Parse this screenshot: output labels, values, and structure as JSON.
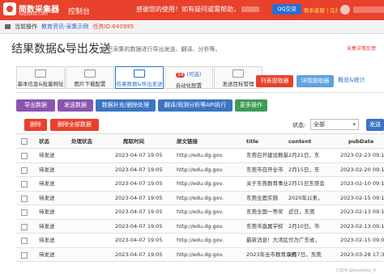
{
  "topbar": {
    "brand": "简数采集器",
    "brand_sub": "keydatas.com",
    "console": "控制台",
    "notice": "感谢您的使用！如有疑问或需帮助，",
    "qq_label": "QQ交谈",
    "contact": "联系客服 | 在线"
  },
  "breadcrumb": {
    "home": "当前操作",
    "section": "教育资讯-采集示例",
    "task": "任务ID:640995"
  },
  "header": {
    "title": "结果数据&导出发送",
    "description": "*对已采集的数据进行导出发送、翻译、分析等。",
    "feedback": "采集详情反馈"
  },
  "steps": [
    {
      "label": "基本信息&批量网址"
    },
    {
      "label": "图片下载配置"
    },
    {
      "label": "结果数据&导出发送",
      "badge": "14"
    },
    {
      "label": "自动化配置",
      "tag": "(可选)"
    },
    {
      "label": "发送目标管理"
    }
  ],
  "header_buttons": {
    "list_extractor": "列表提取器",
    "detail_extractor": "详情提取器",
    "overview": "概览&统计"
  },
  "toolbar": {
    "export": "导出数据",
    "send": "发送数据",
    "supplement": "数据补充/删除处理",
    "translate": "翻译/观测分析等API执行",
    "more": "更多操作"
  },
  "actions": {
    "delete": "删除",
    "delete_all": "删除全部数据",
    "status_label": "状态:",
    "status_value": "全部",
    "send_button": "发送"
  },
  "table": {
    "columns": [
      "状态",
      "处理状态",
      "爬取时间",
      "原文链接",
      "title",
      "content",
      "pubDate"
    ],
    "rows": [
      {
        "status": "待发送",
        "crawl_time": "2023-04-07 19:05",
        "url": "http://edu.dg.gov.",
        "title": "东莞召开建设教基",
        "content": "2月21日，东",
        "pub_date": "2023-02-23 09:14:45"
      },
      {
        "status": "待发送",
        "crawl_time": "2023-04-07 19:05",
        "url": "http://edu.dg.gov.",
        "title": "东莞市召开全市",
        "content": "2月15日，东",
        "pub_date": "2023-02-20 09:15:06"
      },
      {
        "status": "待发送",
        "crawl_time": "2023-04-07 19:05",
        "url": "http://edu.dg.gov.",
        "title": "关于东莞教育事业",
        "content": "2月15日东莞会",
        "pub_date": "2023-02-10 09:15:02"
      },
      {
        "status": "待发送",
        "crawl_time": "2023-04-07 19:05",
        "url": "http://edu.dg.gov.",
        "title": "东莞全面实施",
        "content": "2020年以来，",
        "pub_date": "2023-02-15 09:11:59"
      },
      {
        "status": "待发送",
        "crawl_time": "2023-04-07 19:05",
        "url": "http://edu.dg.gov.",
        "title": "东莞全国一等奖",
        "content": "近日，东莞",
        "pub_date": "2023-02-13 09:11:54"
      },
      {
        "status": "待发送",
        "crawl_time": "2023-04-07 19:05",
        "url": "http://edu.dg.gov.",
        "title": "东莞市直属学校",
        "content": "2月10日，市",
        "pub_date": "2023-02-13 09:10:53"
      },
      {
        "status": "待发送",
        "crawl_time": "2023-04-07 19:05",
        "url": "http://edu.dg.gov.",
        "title": "最新消息！大湾区",
        "content": "作为广东省，",
        "pub_date": "2023-02-15 09:02:13"
      },
      {
        "status": "待发送",
        "crawl_time": "2023-04-07 19:05",
        "url": "http://edu.dg.gov.",
        "title": "2023年全市教育系统",
        "content": "2月7日，东莞",
        "pub_date": "2023-03-28 17:36:02"
      }
    ]
  },
  "watermark": "CSDN @keydatas_9"
}
